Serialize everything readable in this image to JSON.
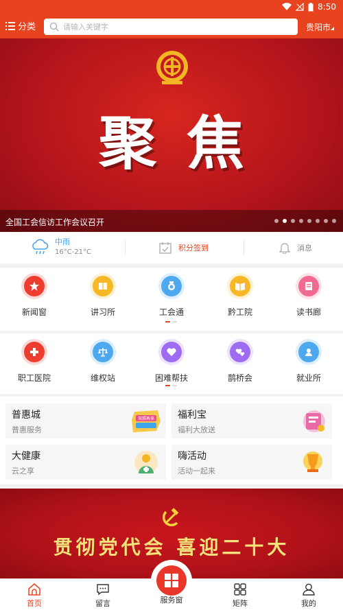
{
  "status_bar": {
    "time": "8:50"
  },
  "header": {
    "category_label": "分类",
    "search_placeholder": "请输入关键字",
    "city": "贵阳市"
  },
  "banner": {
    "headline": "聚焦",
    "caption": "全国工会信访工作会议召开",
    "slide_count": 8,
    "active_slide": 2
  },
  "info_bar": {
    "weather_condition": "中雨",
    "weather_temp": "16°C-21°C",
    "signin_label": "积分签到",
    "message_label": "消息"
  },
  "grid1": [
    {
      "label": "新闻窗",
      "icon": "star-badge-icon",
      "color": "#ec3d2f"
    },
    {
      "label": "讲习所",
      "icon": "book-icon",
      "color": "#f6b827"
    },
    {
      "label": "工会通",
      "icon": "medal-icon",
      "color": "#4ea8ee"
    },
    {
      "label": "黔工院",
      "icon": "open-book-icon",
      "color": "#f6b827"
    },
    {
      "label": "读书廊",
      "icon": "reading-icon",
      "color": "#f06a92"
    }
  ],
  "grid2": [
    {
      "label": "职工医院",
      "icon": "medical-cross-icon",
      "color": "#ec3d2f"
    },
    {
      "label": "维权站",
      "icon": "scales-icon",
      "color": "#4ea8ee"
    },
    {
      "label": "困难帮扶",
      "icon": "heart-hand-icon",
      "color": "#9e6cf0"
    },
    {
      "label": "鹊桥会",
      "icon": "hearts-icon",
      "color": "#9e6cf0"
    },
    {
      "label": "就业所",
      "icon": "person-badge-icon",
      "color": "#4ea8ee"
    }
  ],
  "cards": [
    {
      "title": "普惠城",
      "subtitle": "普惠服务",
      "image_text": "驾照再来"
    },
    {
      "title": "福利宝",
      "subtitle": "福利大放送"
    },
    {
      "title": "大健康",
      "subtitle": "云之享"
    },
    {
      "title": "嗨活动",
      "subtitle": "活动一起来"
    }
  ],
  "banner2": {
    "slogan": "贯彻党代会 喜迎二十大"
  },
  "nav": {
    "home": "首页",
    "comment": "留言",
    "service": "服务窗",
    "matrix": "矩阵",
    "mine": "我的"
  },
  "colors": {
    "brand": "#e8431f",
    "banner_red": "#b3141c",
    "slogan_gold": "#f6e27a"
  }
}
